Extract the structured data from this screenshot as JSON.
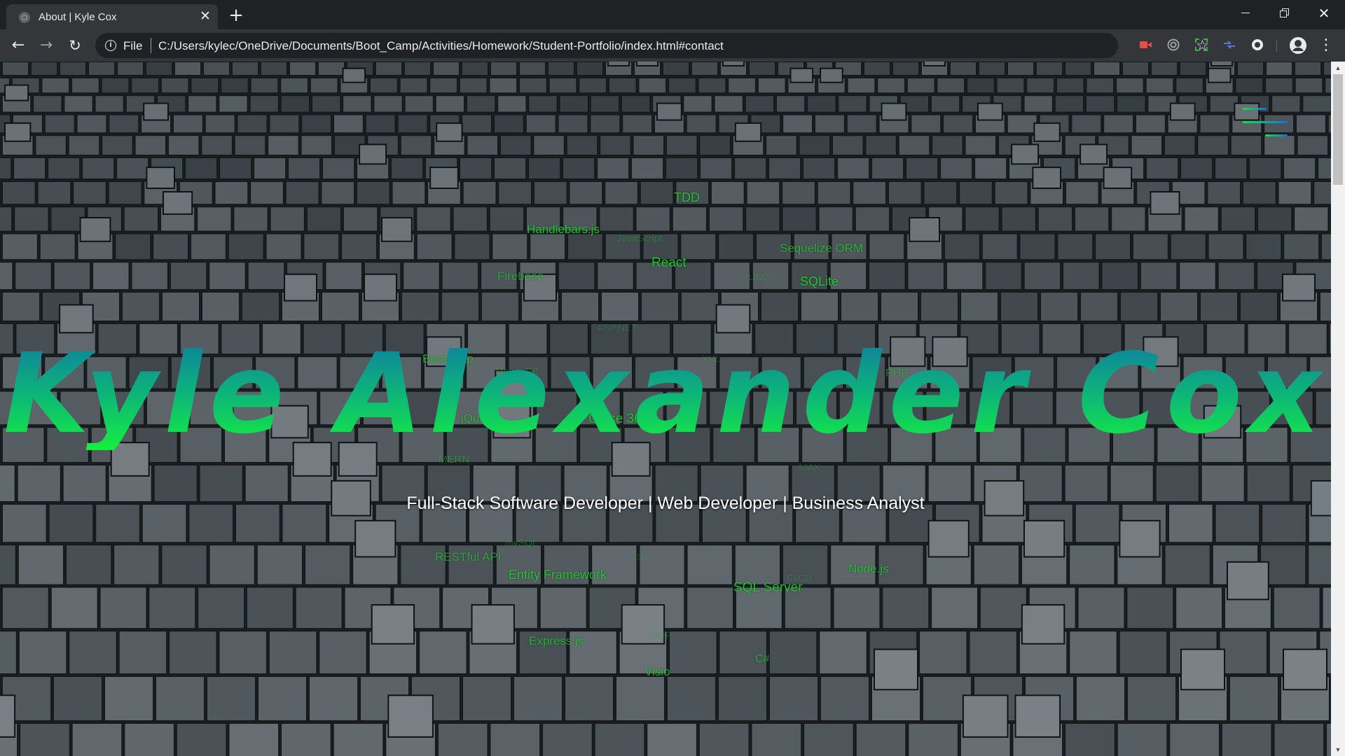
{
  "browser": {
    "tab_title": "About | Kyle Cox",
    "tab_close": "✕",
    "new_tab": "+",
    "back": "←",
    "forward": "→",
    "reload": "↻",
    "url_scheme": "File",
    "url": "C:/Users/kylec/OneDrive/Documents/Boot_Camp/Activities/Homework/Student-Portfolio/index.html#contact",
    "bookmark_icon": "☆",
    "menu_icon": "⋮",
    "close_window": "✕"
  },
  "hero": {
    "title": "Kyle Alexander Cox",
    "subtitle": "Full-Stack Software Developer | Web Developer | Business Analyst"
  },
  "skills": [
    {
      "text": "TDD",
      "opacity": 0.9
    },
    {
      "text": "Handlebars.js",
      "opacity": 0.95
    },
    {
      "text": "JavaScript",
      "opacity": 0.35
    },
    {
      "text": "Sequelize ORM",
      "opacity": 0.75
    },
    {
      "text": "React",
      "opacity": 0.95
    },
    {
      "text": "Firebase",
      "opacity": 0.6
    },
    {
      "text": "LINQ",
      "opacity": 0.35
    },
    {
      "text": "SQLite",
      "opacity": 0.95
    },
    {
      "text": "ASP.NET",
      "opacity": 0.25
    },
    {
      "text": "Bootstrap",
      "opacity": 0.75
    },
    {
      "text": "MongoDB",
      "opacity": 0.35
    },
    {
      "text": "XML",
      "opacity": 0.25
    },
    {
      "text": "PHP",
      "opacity": 0.55
    },
    {
      "text": "jQuery",
      "opacity": 0.7
    },
    {
      "text": "Office 365",
      "opacity": 0.9
    },
    {
      "text": "MERN",
      "opacity": 0.45
    },
    {
      "text": "AJAX",
      "opacity": 0.25
    },
    {
      "text": "mySQL",
      "opacity": 0.4
    },
    {
      "text": "RESTful API",
      "opacity": 0.65
    },
    {
      "text": "JSX",
      "opacity": 0.25
    },
    {
      "text": "Entity Framework",
      "opacity": 0.9
    },
    {
      "text": "CI/CD",
      "opacity": 0.3
    },
    {
      "text": "Node.js",
      "opacity": 0.8
    },
    {
      "text": "SQL Server",
      "opacity": 0.9
    },
    {
      "text": "Express.js",
      "opacity": 0.75
    },
    {
      "text": "OOP",
      "opacity": 0.3
    },
    {
      "text": "C#",
      "opacity": 0.7
    },
    {
      "text": "Visio",
      "opacity": 0.8
    }
  ],
  "colors": {
    "accent_green": "#1fce2c",
    "title_gradient_top": "#0f7ea0",
    "title_gradient_bottom": "#14f03c"
  }
}
